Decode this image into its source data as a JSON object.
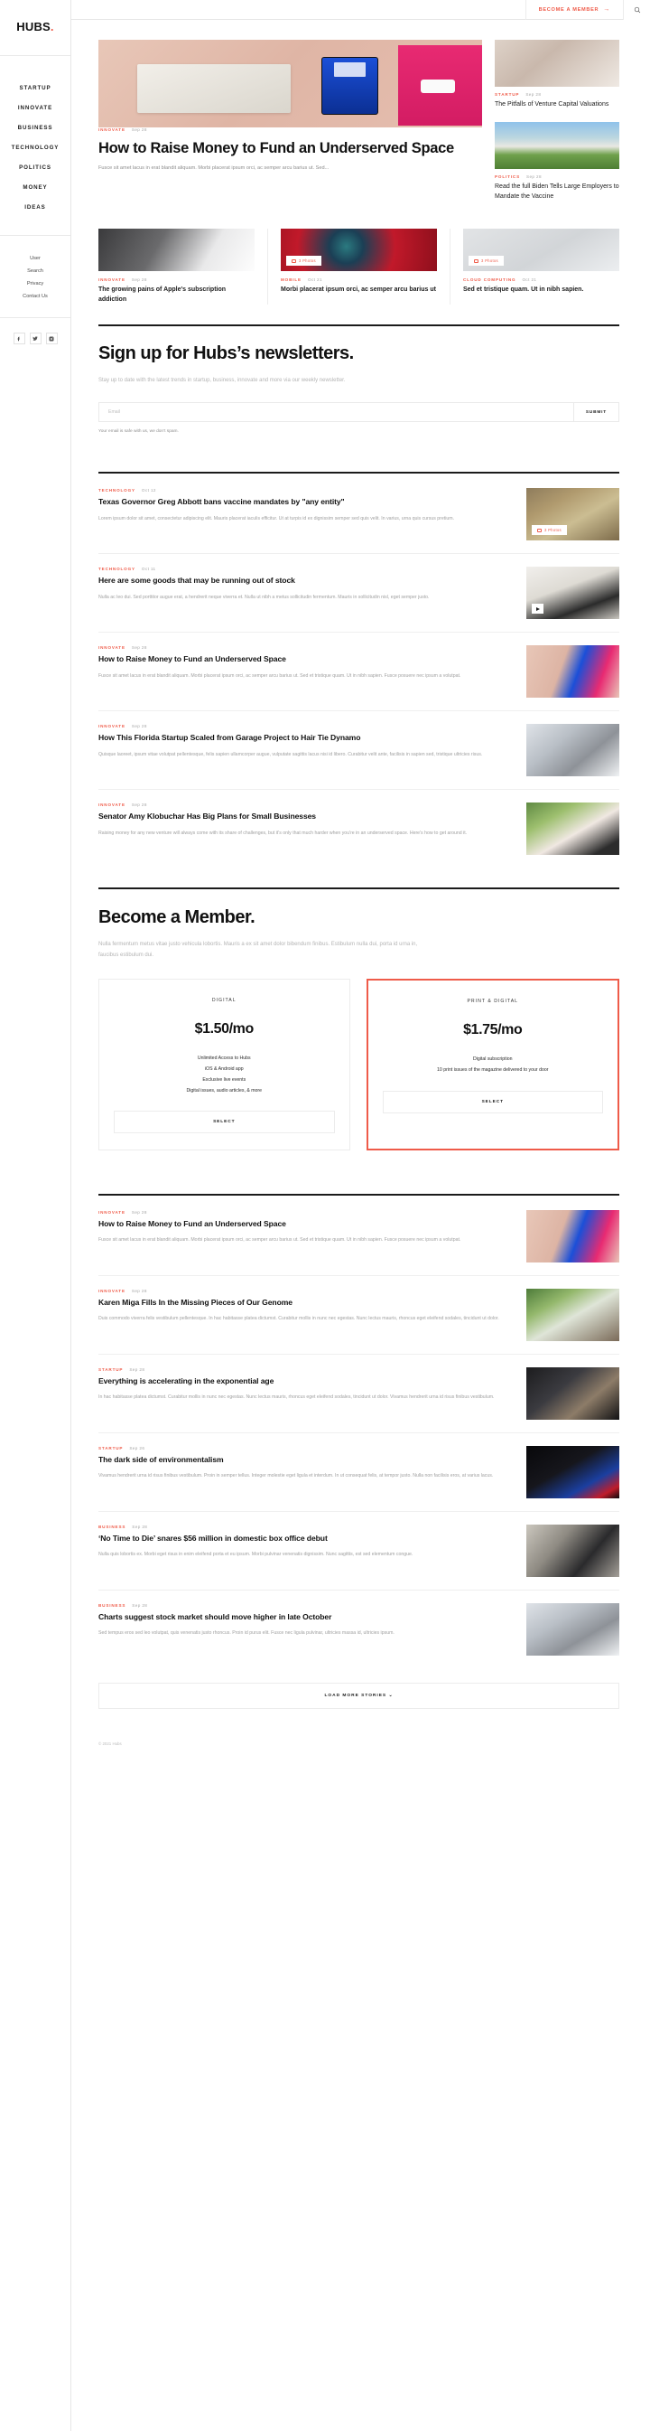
{
  "brand": {
    "name": "HUBS",
    "dot": "."
  },
  "topbar": {
    "member_label": "BECOME A MEMBER",
    "member_arrow": "→",
    "search_icon": "search-icon"
  },
  "sidebar": {
    "primary": [
      {
        "label": "STARTUP"
      },
      {
        "label": "INNOVATE"
      },
      {
        "label": "BUSINESS"
      },
      {
        "label": "TECHNOLOGY"
      },
      {
        "label": "POLITICS"
      },
      {
        "label": "MONEY"
      },
      {
        "label": "IDEAS"
      }
    ],
    "secondary": [
      {
        "label": "User"
      },
      {
        "label": "Search"
      },
      {
        "label": "Privacy"
      },
      {
        "label": "Contact Us"
      }
    ],
    "socials": [
      {
        "name": "facebook-icon"
      },
      {
        "name": "twitter-icon"
      },
      {
        "name": "instagram-icon"
      }
    ]
  },
  "hero": {
    "main": {
      "category": "INNOVATE",
      "date": "Sep 28",
      "title": "How to Raise Money to Fund an Underserved Space",
      "excerpt": "Fusce sit amet lacus in erat blandit aliquam. Morbi placerat ipsum orci, ac semper arcu barius ut. Sed..."
    },
    "side": [
      {
        "category": "STARTUP",
        "date": "Sep 28",
        "title": "The Pitfalls of Venture Capital Valuations"
      },
      {
        "category": "POLITICS",
        "date": "Sep 28",
        "title": "Read the full Biden Tells Large Employers to Mandate the Vaccine"
      }
    ]
  },
  "trio": [
    {
      "category": "INNOVATE",
      "date": "Sep 28",
      "title": "The growing pains of Apple's subscription addiction",
      "badge": null
    },
    {
      "category": "MOBILE",
      "date": "Oct 21",
      "title": "Morbi placerat ipsum orci, ac semper arcu barius ut",
      "badge": "3 Photos"
    },
    {
      "category": "CLOUD COMPUTING",
      "date": "Oct 21",
      "title": "Sed et tristique quam. Ut in nibh sapien.",
      "badge": "3 Photos"
    }
  ],
  "newsletter": {
    "title": "Sign up for Hubs’s newsletters.",
    "subtitle": "Stay up to date with the latest trends in startup, business, innovate and more via our weekly newsletter.",
    "input_placeholder": "Email",
    "input_value": "",
    "submit_label": "SUBMIT",
    "note": "Your email is safe with us, we don’t spam."
  },
  "stories_top": [
    {
      "category": "TECHNOLOGY",
      "date": "Oct 12",
      "title": "Texas Governor Greg Abbott bans vaccine mandates by \"any entity\"",
      "excerpt": "Lorem ipsum dolor sit amet, consectetur adipiscing elit. Mauris placerat iaculis efficitur. Ut at turpis id ex dignissim semper sed quis velit. In varius, urna quis cursus pretium.",
      "badge": "3 Photos",
      "has_play": false,
      "image": "im-a"
    },
    {
      "category": "TECHNOLOGY",
      "date": "Oct 11",
      "title": "Here are some goods that may be running out of stock",
      "excerpt": "Nulla ac leo dui. Sed porttitor augue erat, a hendrerit neque viverra et. Nulla ut nibh a metus sollicitudin fermentum. Mauris in sollicitudin nisl, eget semper justo.",
      "badge": null,
      "has_play": true,
      "image": "im-b"
    },
    {
      "category": "INNOVATE",
      "date": "Sep 28",
      "title": "How to Raise Money to Fund an Underserved Space",
      "excerpt": "Fusce sit amet lacus in erat blandit aliquam. Morbi placerat ipsum orci, ac semper arcu barius ut. Sed et tristique quam. Ut in nibh sapien. Fusce posuere nec ipsum a volutpat.",
      "badge": null,
      "has_play": false,
      "image": "im-c"
    },
    {
      "category": "INNOVATE",
      "date": "Sep 28",
      "title": "How This Florida Startup Scaled from Garage Project to Hair Tie Dynamo",
      "excerpt": "Quisque laoreet, ipsum vitae volutpat pellentesque, felis sapien ullamcorper augue, vulputate sagittis lacus nisi id libero. Curabitur velit ante, facilisis in sapien sed, tristique ultricies risus.",
      "badge": null,
      "has_play": false,
      "image": "im-d"
    },
    {
      "category": "INNOVATE",
      "date": "Sep 28",
      "title": "Senator Amy Klobuchar Has Big Plans for Small Businesses",
      "excerpt": "Raising money for any new venture will always come with its share of challenges, but it's only that much harder when you're in an underserved space. Here's how to get around it.",
      "badge": null,
      "has_play": false,
      "image": "im-e"
    }
  ],
  "member": {
    "title": "Become a Member.",
    "subtitle": "Nulla fermentum metus vitae justo vehicula lobortis. Mauris a ex sit amet dolor bibendum finibus. Estibulum nulla dui, porta id urna in, faucibus estibulum dui.",
    "plans": [
      {
        "name": "DIGITAL",
        "price": "$1.50/mo",
        "features": [
          "Unlimited Access to Hubs",
          "iOS & Android app",
          "Exclusive live events",
          "Digital issues, audio articles, & more"
        ],
        "button": "SELECT",
        "featured": false
      },
      {
        "name": "PRINT & DIGITAL",
        "price": "$1.75/mo",
        "features": [
          "Digital subscription",
          "10 print issues of the magazine delivered to your door"
        ],
        "button": "SELECT",
        "featured": true
      }
    ]
  },
  "stories_bottom": [
    {
      "category": "INNOVATE",
      "date": "Sep 28",
      "title": "How to Raise Money to Fund an Underserved Space",
      "excerpt": "Fusce sit amet lacus in erat blandit aliquam. Morbi placerat ipsum orci, ac semper arcu barius ut. Sed et tristique quam. Ut in nibh sapien. Fusce posuere nec ipsum a volutpat.",
      "image": "im-c"
    },
    {
      "category": "INNOVATE",
      "date": "Sep 28",
      "title": "Karen Miga Fills In the Missing Pieces of Our Genome",
      "excerpt": "Duis commodo viverra felis vestibulum pellentesque. In hac habitasse platea dictumst. Curabitur mollis in nunc nec egestas. Nunc lectus mauris, rhoncus eget eleifend sodales, tincidunt ut dolor.",
      "image": "im-f"
    },
    {
      "category": "STARTUP",
      "date": "Sep 28",
      "title": "Everything is accelerating in the exponential age",
      "excerpt": "In hac habitasse platea dictumst. Curabitur mollis in nunc nec egestas. Nunc lectus mauris, rhoncus eget eleifend sodales, tincidunt ut dolor. Vivamus hendrerit urna id risus finibus vestibulum.",
      "image": "im-g"
    },
    {
      "category": "STARTUP",
      "date": "Sep 26",
      "title": "The dark side of environmentalism",
      "excerpt": "Vivamus hendrerit urna id risus finibus vestibulum. Proin in semper tellus. Integer molestie eget ligula et interdum. In ut consequat felis, at tempor justo. Nulla non facilisis eros, at varius lacus.",
      "image": "im-h"
    },
    {
      "category": "BUSINESS",
      "date": "Sep 28",
      "title": "‘No Time to Die’ snares $56 million in domestic box office debut",
      "excerpt": "Nulla quis lobortis ex. Morbi eget risus in enim eleifend porta et eu ipsum. Morbi pulvinar venenatis dignissim. Nunc sagittis, est sed elementum congue.",
      "image": "im-i"
    },
    {
      "category": "BUSINESS",
      "date": "Sep 28",
      "title": "Charts suggest stock market should move higher in late October",
      "excerpt": "Sed tempus eros sed leo volutpat, quis venenatis justo rhoncus. Proin id purus elit. Fusce nec ligula pulvinar, ultricies massa id, ultricies ipsum.",
      "image": "im-j"
    }
  ],
  "load_more": {
    "label": "LOAD MORE STORIES",
    "chevron": "⌄"
  },
  "footer": {
    "copyright": "© 2021 Hubs"
  },
  "colors": {
    "accent": "#ef5b49",
    "text": "#1b1b1b",
    "muted": "#a0a0a0"
  }
}
